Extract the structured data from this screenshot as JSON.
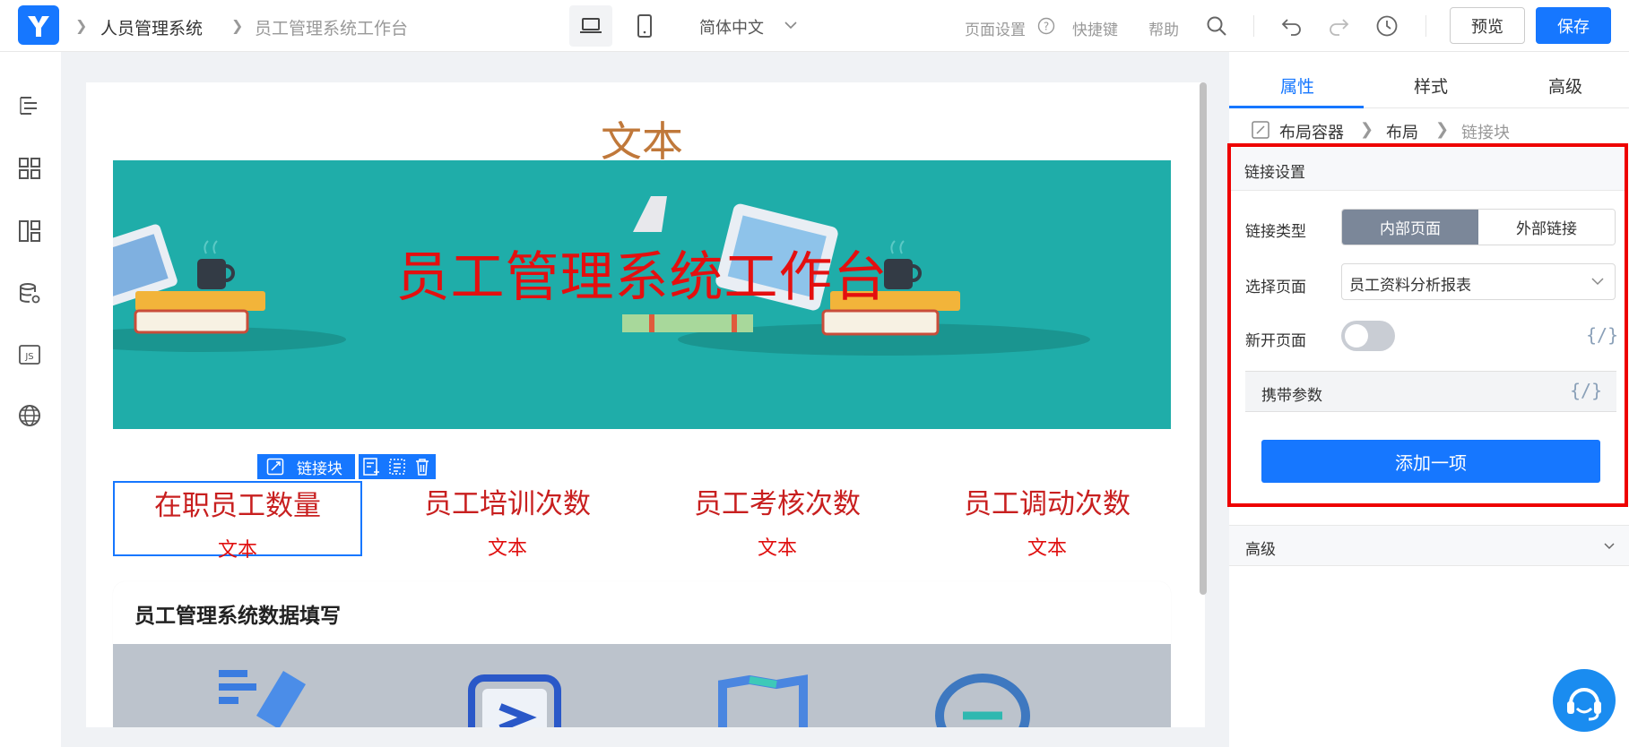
{
  "header": {
    "app_name": "人员管理系统",
    "page_name": "员工管理系统工作台",
    "language": "简体中文",
    "page_settings": "页面设置",
    "shortcuts": "快捷键",
    "help": "帮助",
    "preview_label": "预览",
    "save_label": "保存"
  },
  "canvas": {
    "top_text": "文本",
    "banner_title": "员工管理系统工作台",
    "selection_tag": "链接块",
    "stats": [
      {
        "title": "在职员工数量",
        "sub": "文本"
      },
      {
        "title": "员工培训次数",
        "sub": "文本"
      },
      {
        "title": "员工考核次数",
        "sub": "文本"
      },
      {
        "title": "员工调动次数",
        "sub": "文本"
      }
    ],
    "section_title": "员工管理系统数据填写"
  },
  "panel": {
    "tabs": [
      "属性",
      "样式",
      "高级"
    ],
    "breadcrumb": [
      "布局容器",
      "布局",
      "链接块"
    ],
    "section_title": "链接设置",
    "link_type_label": "链接类型",
    "link_type_options": [
      "内部页面",
      "外部链接"
    ],
    "select_page_label": "选择页面",
    "select_page_value": "员工资料分析报表",
    "new_page_label": "新开页面",
    "params_label": "携带参数",
    "code_symbol": "{/}",
    "add_button": "添加一项",
    "advanced_label": "高级"
  },
  "colors": {
    "accent": "#1677ff",
    "highlight": "#ee0000",
    "banner": "#1fada9",
    "stat_text": "#c81f1f"
  }
}
